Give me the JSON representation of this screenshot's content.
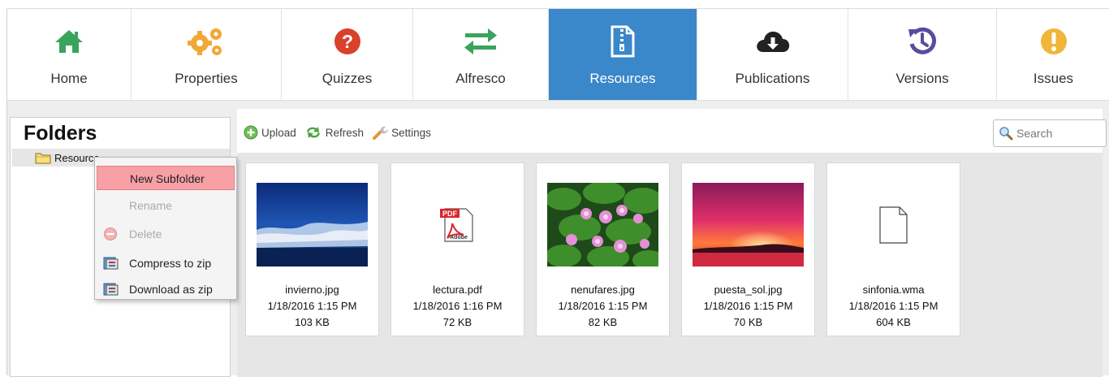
{
  "tabs": [
    {
      "label": "Home",
      "icon": "home-icon",
      "color": "#3aa35d"
    },
    {
      "label": "Properties",
      "icon": "gears-icon",
      "color": "#f0a938"
    },
    {
      "label": "Quizzes",
      "icon": "question-icon",
      "color": "#d9412b"
    },
    {
      "label": "Alfresco",
      "icon": "exchange-icon",
      "color": "#3aa35d"
    },
    {
      "label": "Resources",
      "icon": "file-zip-icon",
      "color": "#ffffff",
      "active": true
    },
    {
      "label": "Publications",
      "icon": "cloud-download-icon",
      "color": "#222222"
    },
    {
      "label": "Versions",
      "icon": "history-icon",
      "color": "#5b4a9e"
    },
    {
      "label": "Issues",
      "icon": "exclamation-icon",
      "color": "#f0b63a"
    }
  ],
  "folders": {
    "title": "Folders",
    "tree": [
      {
        "label": "Resources"
      }
    ]
  },
  "toolbar": {
    "upload": "Upload",
    "refresh": "Refresh",
    "settings": "Settings"
  },
  "search": {
    "placeholder": "Search"
  },
  "context_menu": {
    "items": [
      {
        "label": "New Subfolder",
        "state": "highlighted"
      },
      {
        "label": "Rename",
        "state": "disabled"
      },
      {
        "label": "Delete",
        "state": "disabled",
        "icon": "minus-circle-icon"
      },
      {
        "label": "Compress to zip",
        "icon": "zip-icon"
      },
      {
        "label": "Download as zip",
        "icon": "zip-icon"
      }
    ]
  },
  "files": [
    {
      "name": "invierno.jpg",
      "date": "1/18/2016 1:15 PM",
      "size": "103 KB",
      "kind": "image-winter"
    },
    {
      "name": "lectura.pdf",
      "date": "1/18/2016 1:16 PM",
      "size": "72 KB",
      "kind": "pdf-icon"
    },
    {
      "name": "nenufares.jpg",
      "date": "1/18/2016 1:15 PM",
      "size": "82 KB",
      "kind": "image-waterlilies"
    },
    {
      "name": "puesta_sol.jpg",
      "date": "1/18/2016 1:15 PM",
      "size": "70 KB",
      "kind": "image-sunset"
    },
    {
      "name": "sinfonia.wma",
      "date": "1/18/2016 1:15 PM",
      "size": "604 KB",
      "kind": "generic-file-icon"
    }
  ],
  "colors": {
    "accent": "#3a87c9",
    "highlight": "#f7a0a6"
  }
}
